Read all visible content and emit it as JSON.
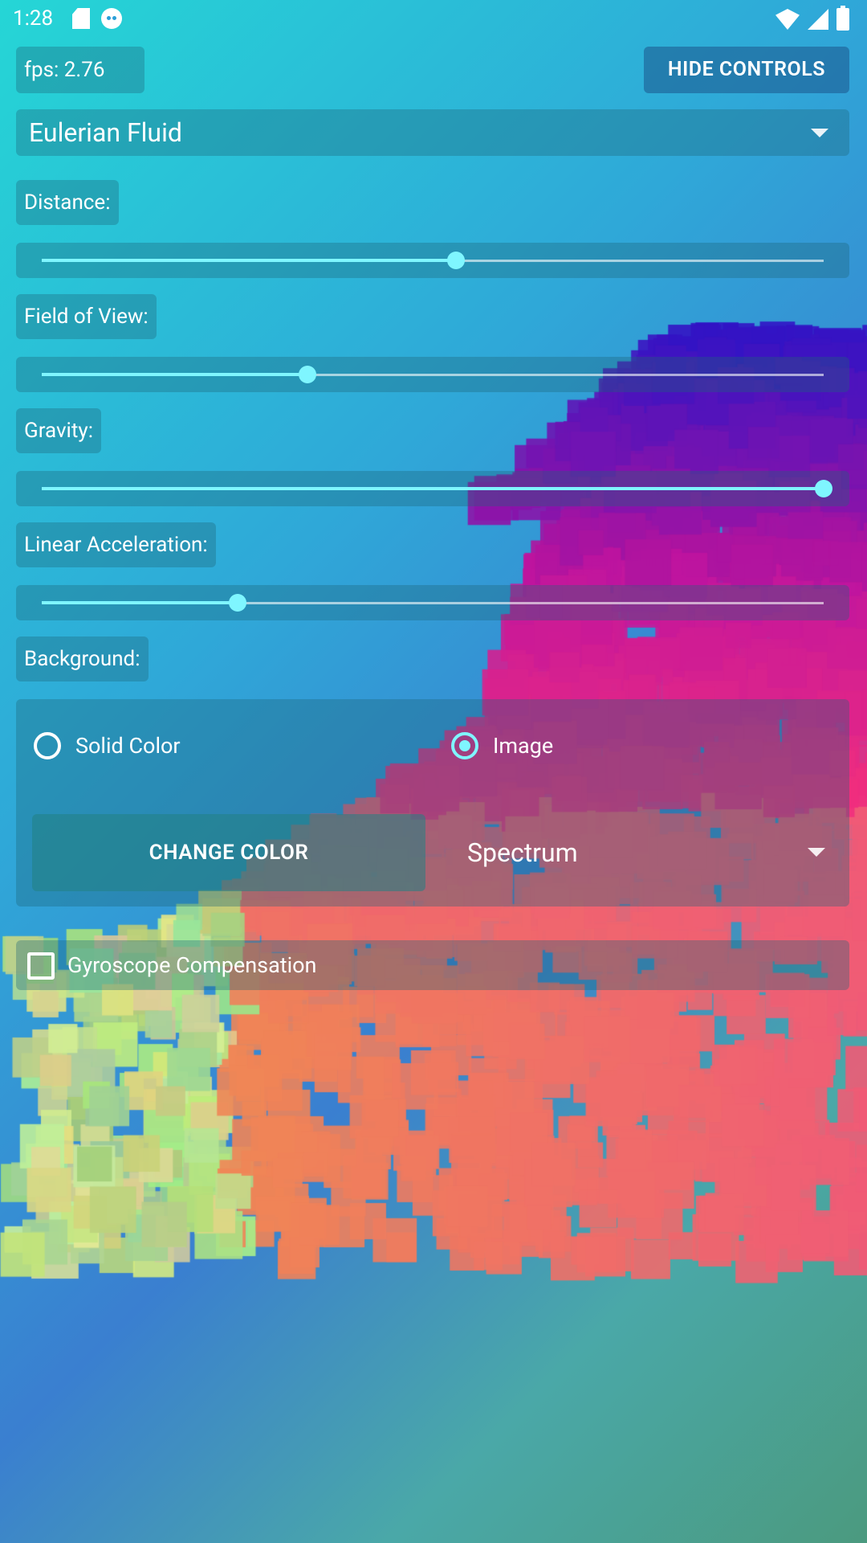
{
  "status_bar": {
    "time": "1:28",
    "left_icons": [
      "sd-card-icon",
      "android-debug-icon"
    ],
    "right_icons": [
      "wifi-icon",
      "signal-icon",
      "battery-icon"
    ]
  },
  "fps_label": "fps: 2.76",
  "hide_controls_label": "HIDE CONTROLS",
  "simulation_select": {
    "selected": "Eulerian Fluid"
  },
  "sliders": [
    {
      "label": "Distance:",
      "value_fraction": 0.53
    },
    {
      "label": "Field of View:",
      "value_fraction": 0.34
    },
    {
      "label": "Gravity:",
      "value_fraction": 1.0
    },
    {
      "label": "Linear Acceleration:",
      "value_fraction": 0.25
    }
  ],
  "background": {
    "label": "Background:",
    "options": [
      {
        "label": "Solid Color",
        "checked": false
      },
      {
        "label": "Image",
        "checked": true
      }
    ],
    "change_color_label": "CHANGE COLOR",
    "image_select": {
      "selected": "Spectrum"
    }
  },
  "gyroscope": {
    "label": "Gyroscope Compensation",
    "checked": false
  },
  "colors": {
    "accent": "#7ff6ff",
    "button_blue": "#1c558c"
  }
}
